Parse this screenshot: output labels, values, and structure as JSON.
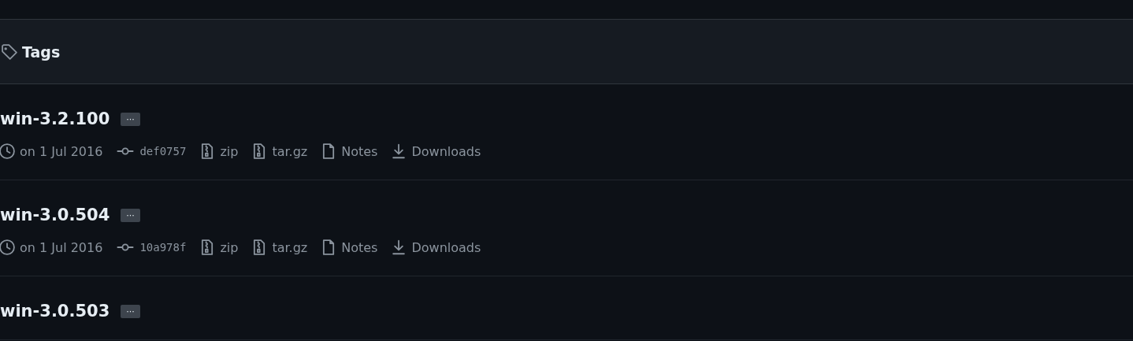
{
  "header": {
    "title": "Tags"
  },
  "tags": [
    {
      "name": "win-3.2.100",
      "menu": "···",
      "date": "on 1 Jul 2016",
      "commit": "def0757",
      "assets": [
        {
          "kind": "zip",
          "label": "zip"
        },
        {
          "kind": "zip",
          "label": "tar.gz"
        },
        {
          "kind": "notes",
          "label": "Notes"
        },
        {
          "kind": "download",
          "label": "Downloads"
        }
      ]
    },
    {
      "name": "win-3.0.504",
      "menu": "···",
      "date": "on 1 Jul 2016",
      "commit": "10a978f",
      "assets": [
        {
          "kind": "zip",
          "label": "zip"
        },
        {
          "kind": "zip",
          "label": "tar.gz"
        },
        {
          "kind": "notes",
          "label": "Notes"
        },
        {
          "kind": "download",
          "label": "Downloads"
        }
      ]
    },
    {
      "name": "win-3.0.503",
      "menu": "···"
    }
  ]
}
